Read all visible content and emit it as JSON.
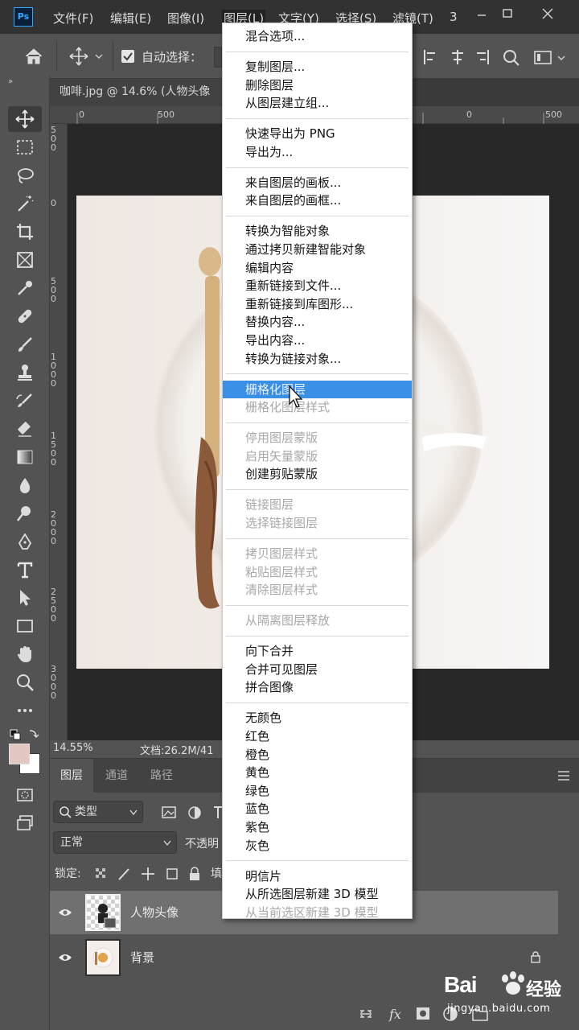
{
  "app": {
    "logo": "Ps",
    "menus": [
      "文件(F)",
      "编辑(E)",
      "图像(I)",
      "图层(L)",
      "文字(Y)",
      "选择(S)",
      "滤镜(T)",
      "3"
    ],
    "window_controls": [
      "minimize-icon",
      "maximize-icon",
      "close-icon"
    ]
  },
  "options_bar": {
    "auto_select_label": "自动选择：",
    "auto_select_checked": true
  },
  "document": {
    "tab_title": "咖啡.jpg @ 14.6% (人物头像",
    "ruler_h_ticks": [
      "0",
      "500",
      "0",
      "500"
    ],
    "ruler_v_ticks": [
      "5\n0\n0",
      "0",
      "5\n0\n0",
      "1\n0\n0\n0",
      "1\n5\n0\n0",
      "2\n0\n0\n0",
      "2\n5\n0\n0",
      "3\n0\n0\n0"
    ],
    "zoom": "14.55%",
    "doc_info": "文档:26.2M/41"
  },
  "layers_panel": {
    "tabs": [
      "图层",
      "通道",
      "路径"
    ],
    "active_tab": 0,
    "filter_kind": "类型",
    "blend_mode": "正常",
    "opacity_label": "不透明",
    "lock_label": "锁定:",
    "fill_label": "填",
    "layers": [
      {
        "name": "人物头像",
        "selected": true,
        "visible": true,
        "locked": false
      },
      {
        "name": "背景",
        "selected": false,
        "visible": true,
        "locked": true
      }
    ]
  },
  "context_menu": {
    "groups": [
      [
        {
          "label": "混合选项...",
          "disabled": false
        }
      ],
      [
        {
          "label": "复制图层...",
          "disabled": false
        },
        {
          "label": "删除图层",
          "disabled": false
        },
        {
          "label": "从图层建立组...",
          "disabled": false
        }
      ],
      [
        {
          "label": "快速导出为 PNG",
          "disabled": false
        },
        {
          "label": "导出为...",
          "disabled": false
        }
      ],
      [
        {
          "label": "来自图层的画板...",
          "disabled": false
        },
        {
          "label": "来自图层的画框...",
          "disabled": false
        }
      ],
      [
        {
          "label": "转换为智能对象",
          "disabled": false
        },
        {
          "label": "通过拷贝新建智能对象",
          "disabled": false
        },
        {
          "label": "编辑内容",
          "disabled": false
        },
        {
          "label": "重新链接到文件...",
          "disabled": false
        },
        {
          "label": "重新链接到库图形...",
          "disabled": false
        },
        {
          "label": "替换内容...",
          "disabled": false
        },
        {
          "label": "导出内容...",
          "disabled": false
        },
        {
          "label": "转换为链接对象...",
          "disabled": false
        }
      ],
      [
        {
          "label": "栅格化图层",
          "disabled": false,
          "highlighted": true
        },
        {
          "label": "栅格化图层样式",
          "disabled": true
        }
      ],
      [
        {
          "label": "停用图层蒙版",
          "disabled": true
        },
        {
          "label": "启用矢量蒙版",
          "disabled": true
        },
        {
          "label": "创建剪贴蒙版",
          "disabled": false
        }
      ],
      [
        {
          "label": "链接图层",
          "disabled": true
        },
        {
          "label": "选择链接图层",
          "disabled": true
        }
      ],
      [
        {
          "label": "拷贝图层样式",
          "disabled": true
        },
        {
          "label": "粘贴图层样式",
          "disabled": true
        },
        {
          "label": "清除图层样式",
          "disabled": true
        }
      ],
      [
        {
          "label": "从隔离图层释放",
          "disabled": true
        }
      ],
      [
        {
          "label": "向下合并",
          "disabled": false
        },
        {
          "label": "合并可见图层",
          "disabled": false
        },
        {
          "label": "拼合图像",
          "disabled": false
        }
      ],
      [
        {
          "label": "无颜色",
          "disabled": false
        },
        {
          "label": "红色",
          "disabled": false
        },
        {
          "label": "橙色",
          "disabled": false
        },
        {
          "label": "黄色",
          "disabled": false
        },
        {
          "label": "绿色",
          "disabled": false
        },
        {
          "label": "蓝色",
          "disabled": false
        },
        {
          "label": "紫色",
          "disabled": false
        },
        {
          "label": "灰色",
          "disabled": false
        }
      ],
      [
        {
          "label": "明信片",
          "disabled": false
        },
        {
          "label": "从所选图层新建 3D 模型",
          "disabled": false
        },
        {
          "label": "从当前选区新建 3D 模型",
          "disabled": true
        }
      ]
    ]
  },
  "watermark": {
    "brand": "Bai",
    "brand_suffix": "经验",
    "url": "jingyan.baidu.com"
  },
  "colors": {
    "menubar_bg": "#323232",
    "panel_bg": "#535353",
    "highlight": "#3990e6",
    "selected_layer": "#707070"
  }
}
